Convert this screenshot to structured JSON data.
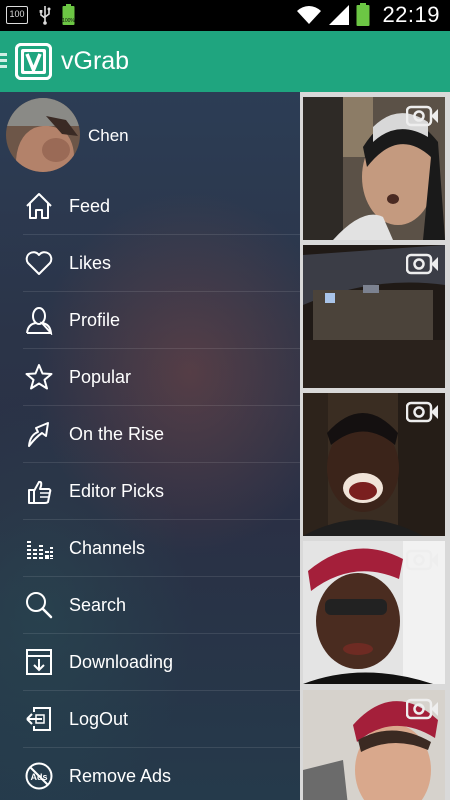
{
  "status_bar": {
    "battery_percent": "100",
    "battery_small": "100%",
    "time": "22:19"
  },
  "app_bar": {
    "title": "vGrab",
    "logo_letter": "V"
  },
  "profile": {
    "name": "Chen"
  },
  "menu": [
    {
      "label": "Feed",
      "icon": "home-icon"
    },
    {
      "label": "Likes",
      "icon": "heart-icon"
    },
    {
      "label": "Profile",
      "icon": "person-icon"
    },
    {
      "label": "Popular",
      "icon": "star-icon"
    },
    {
      "label": "On the Rise",
      "icon": "rising-arrow-icon"
    },
    {
      "label": "Editor Picks",
      "icon": "thumbs-up-icon"
    },
    {
      "label": "Channels",
      "icon": "equalizer-icon"
    },
    {
      "label": "Search",
      "icon": "search-icon"
    },
    {
      "label": "Downloading",
      "icon": "download-icon"
    },
    {
      "label": "LogOut",
      "icon": "logout-icon"
    },
    {
      "label": "Remove Ads",
      "icon": "no-ads-icon"
    }
  ],
  "remove_ads_badge": "Ads",
  "colors": {
    "accent": "#1fa57f",
    "status_bar": "#000000",
    "battery_green": "#6cc644"
  }
}
